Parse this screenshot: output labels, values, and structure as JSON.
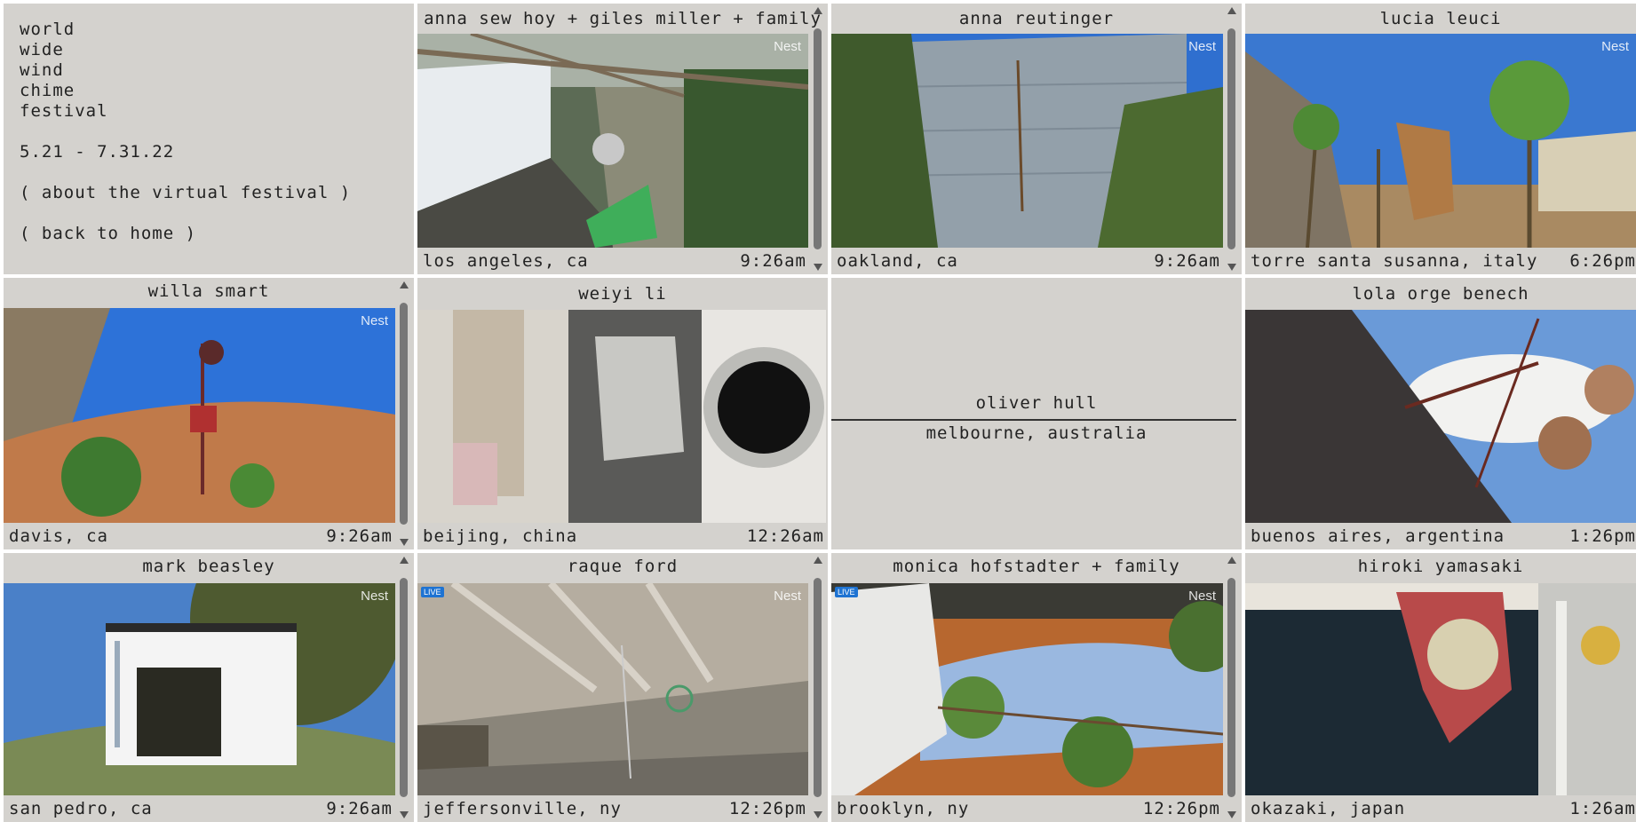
{
  "intro": {
    "title_lines": [
      "world",
      "wide",
      "wind",
      "chime",
      "festival"
    ],
    "dates": "5.21 - 7.31.22",
    "about_link": "( about the virtual festival )",
    "home_link": "( back to home )"
  },
  "watermark": "Nest",
  "live_badge": "LIVE",
  "cells": [
    {
      "name": "anna sew hoy + giles miller + family",
      "location": "los angeles, ca",
      "time": "9:26am"
    },
    {
      "name": "anna reutinger",
      "location": "oakland, ca",
      "time": "9:26am"
    },
    {
      "name": "lucia leuci",
      "location": "torre santa susanna, italy",
      "time": "6:26pm"
    },
    {
      "name": "willa smart",
      "location": "davis, ca",
      "time": "9:26am"
    },
    {
      "name": "weiyi li",
      "location": "beijing, china",
      "time": "12:26am"
    },
    {
      "name": "oliver hull",
      "location": "melbourne, australia",
      "time": ""
    },
    {
      "name": "lola orge benech",
      "location": "buenos aires, argentina",
      "time": "1:26pm"
    },
    {
      "name": "mark beasley",
      "location": "san pedro, ca",
      "time": "9:26am"
    },
    {
      "name": "raque ford",
      "location": "jeffersonville, ny",
      "time": "12:26pm"
    },
    {
      "name": "monica hofstadter + family",
      "location": "brooklyn, ny",
      "time": "12:26pm"
    },
    {
      "name": "hiroki yamasaki",
      "location": "okazaki, japan",
      "time": "1:26am"
    }
  ],
  "colors": {
    "panel": "#d4d2ce",
    "text": "#222222",
    "sky": "#3a78d0"
  }
}
